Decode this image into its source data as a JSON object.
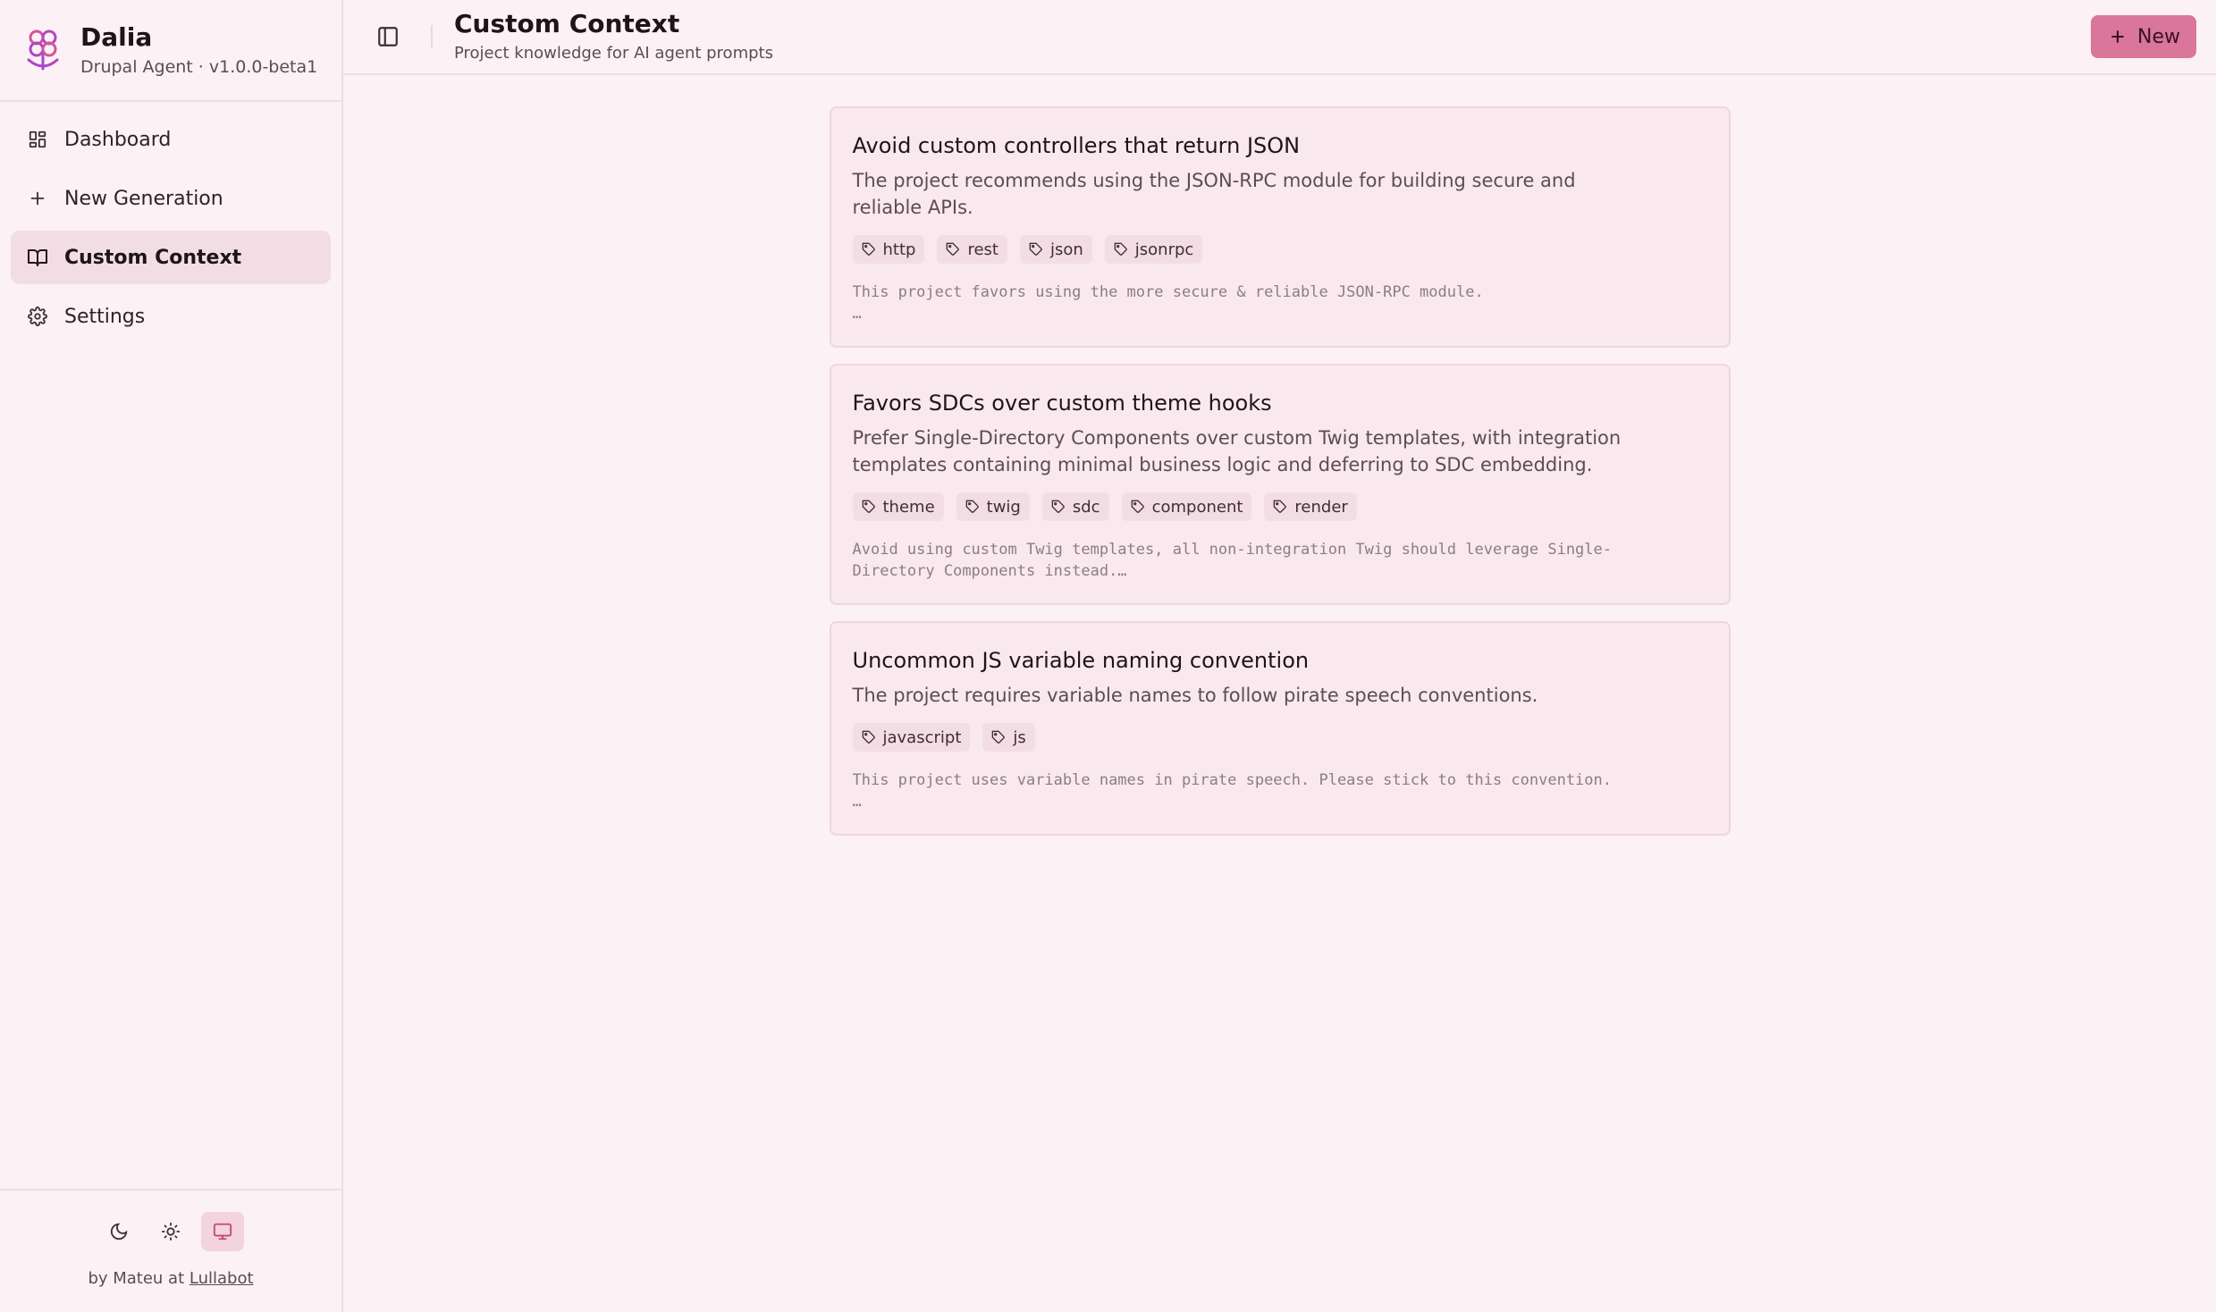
{
  "brand": {
    "title": "Dalia",
    "subtitle": "Drupal Agent · v1.0.0-beta1"
  },
  "nav": {
    "items": [
      {
        "label": "Dashboard",
        "icon": "grid-icon"
      },
      {
        "label": "New Generation",
        "icon": "plus-icon"
      },
      {
        "label": "Custom Context",
        "icon": "book-open-icon",
        "active": true
      },
      {
        "label": "Settings",
        "icon": "gear-icon"
      }
    ]
  },
  "footer": {
    "credit_prefix": "by Mateu at",
    "credit_link": "Lullabot",
    "theme_options": [
      "dark",
      "light",
      "system"
    ],
    "active_theme": "system"
  },
  "header": {
    "title": "Custom Context",
    "subtitle": "Project knowledge for AI agent prompts",
    "new_label": "New"
  },
  "colors": {
    "accent": "#d97699",
    "background": "#fcf1f4",
    "card": "#f9e9ee"
  },
  "contexts": [
    {
      "title": "Avoid custom controllers that return JSON",
      "description": "The project recommends using the JSON-RPC module for building secure and reliable APIs.",
      "tags": [
        "http",
        "rest",
        "json",
        "jsonrpc"
      ],
      "body": "This project favors using the more secure & reliable JSON-RPC module.\n…"
    },
    {
      "title": "Favors SDCs over custom theme hooks",
      "description": "Prefer Single-Directory Components over custom Twig templates, with integration templates containing minimal business logic and deferring to SDC embedding.",
      "tags": [
        "theme",
        "twig",
        "sdc",
        "component",
        "render"
      ],
      "body": "Avoid using custom Twig templates, all non-integration Twig should leverage Single-Directory Components instead.…"
    },
    {
      "title": "Uncommon JS variable naming convention",
      "description": "The project requires variable names to follow pirate speech conventions.",
      "tags": [
        "javascript",
        "js"
      ],
      "body": "This project uses variable names in pirate speech. Please stick to this convention.\n…"
    }
  ]
}
